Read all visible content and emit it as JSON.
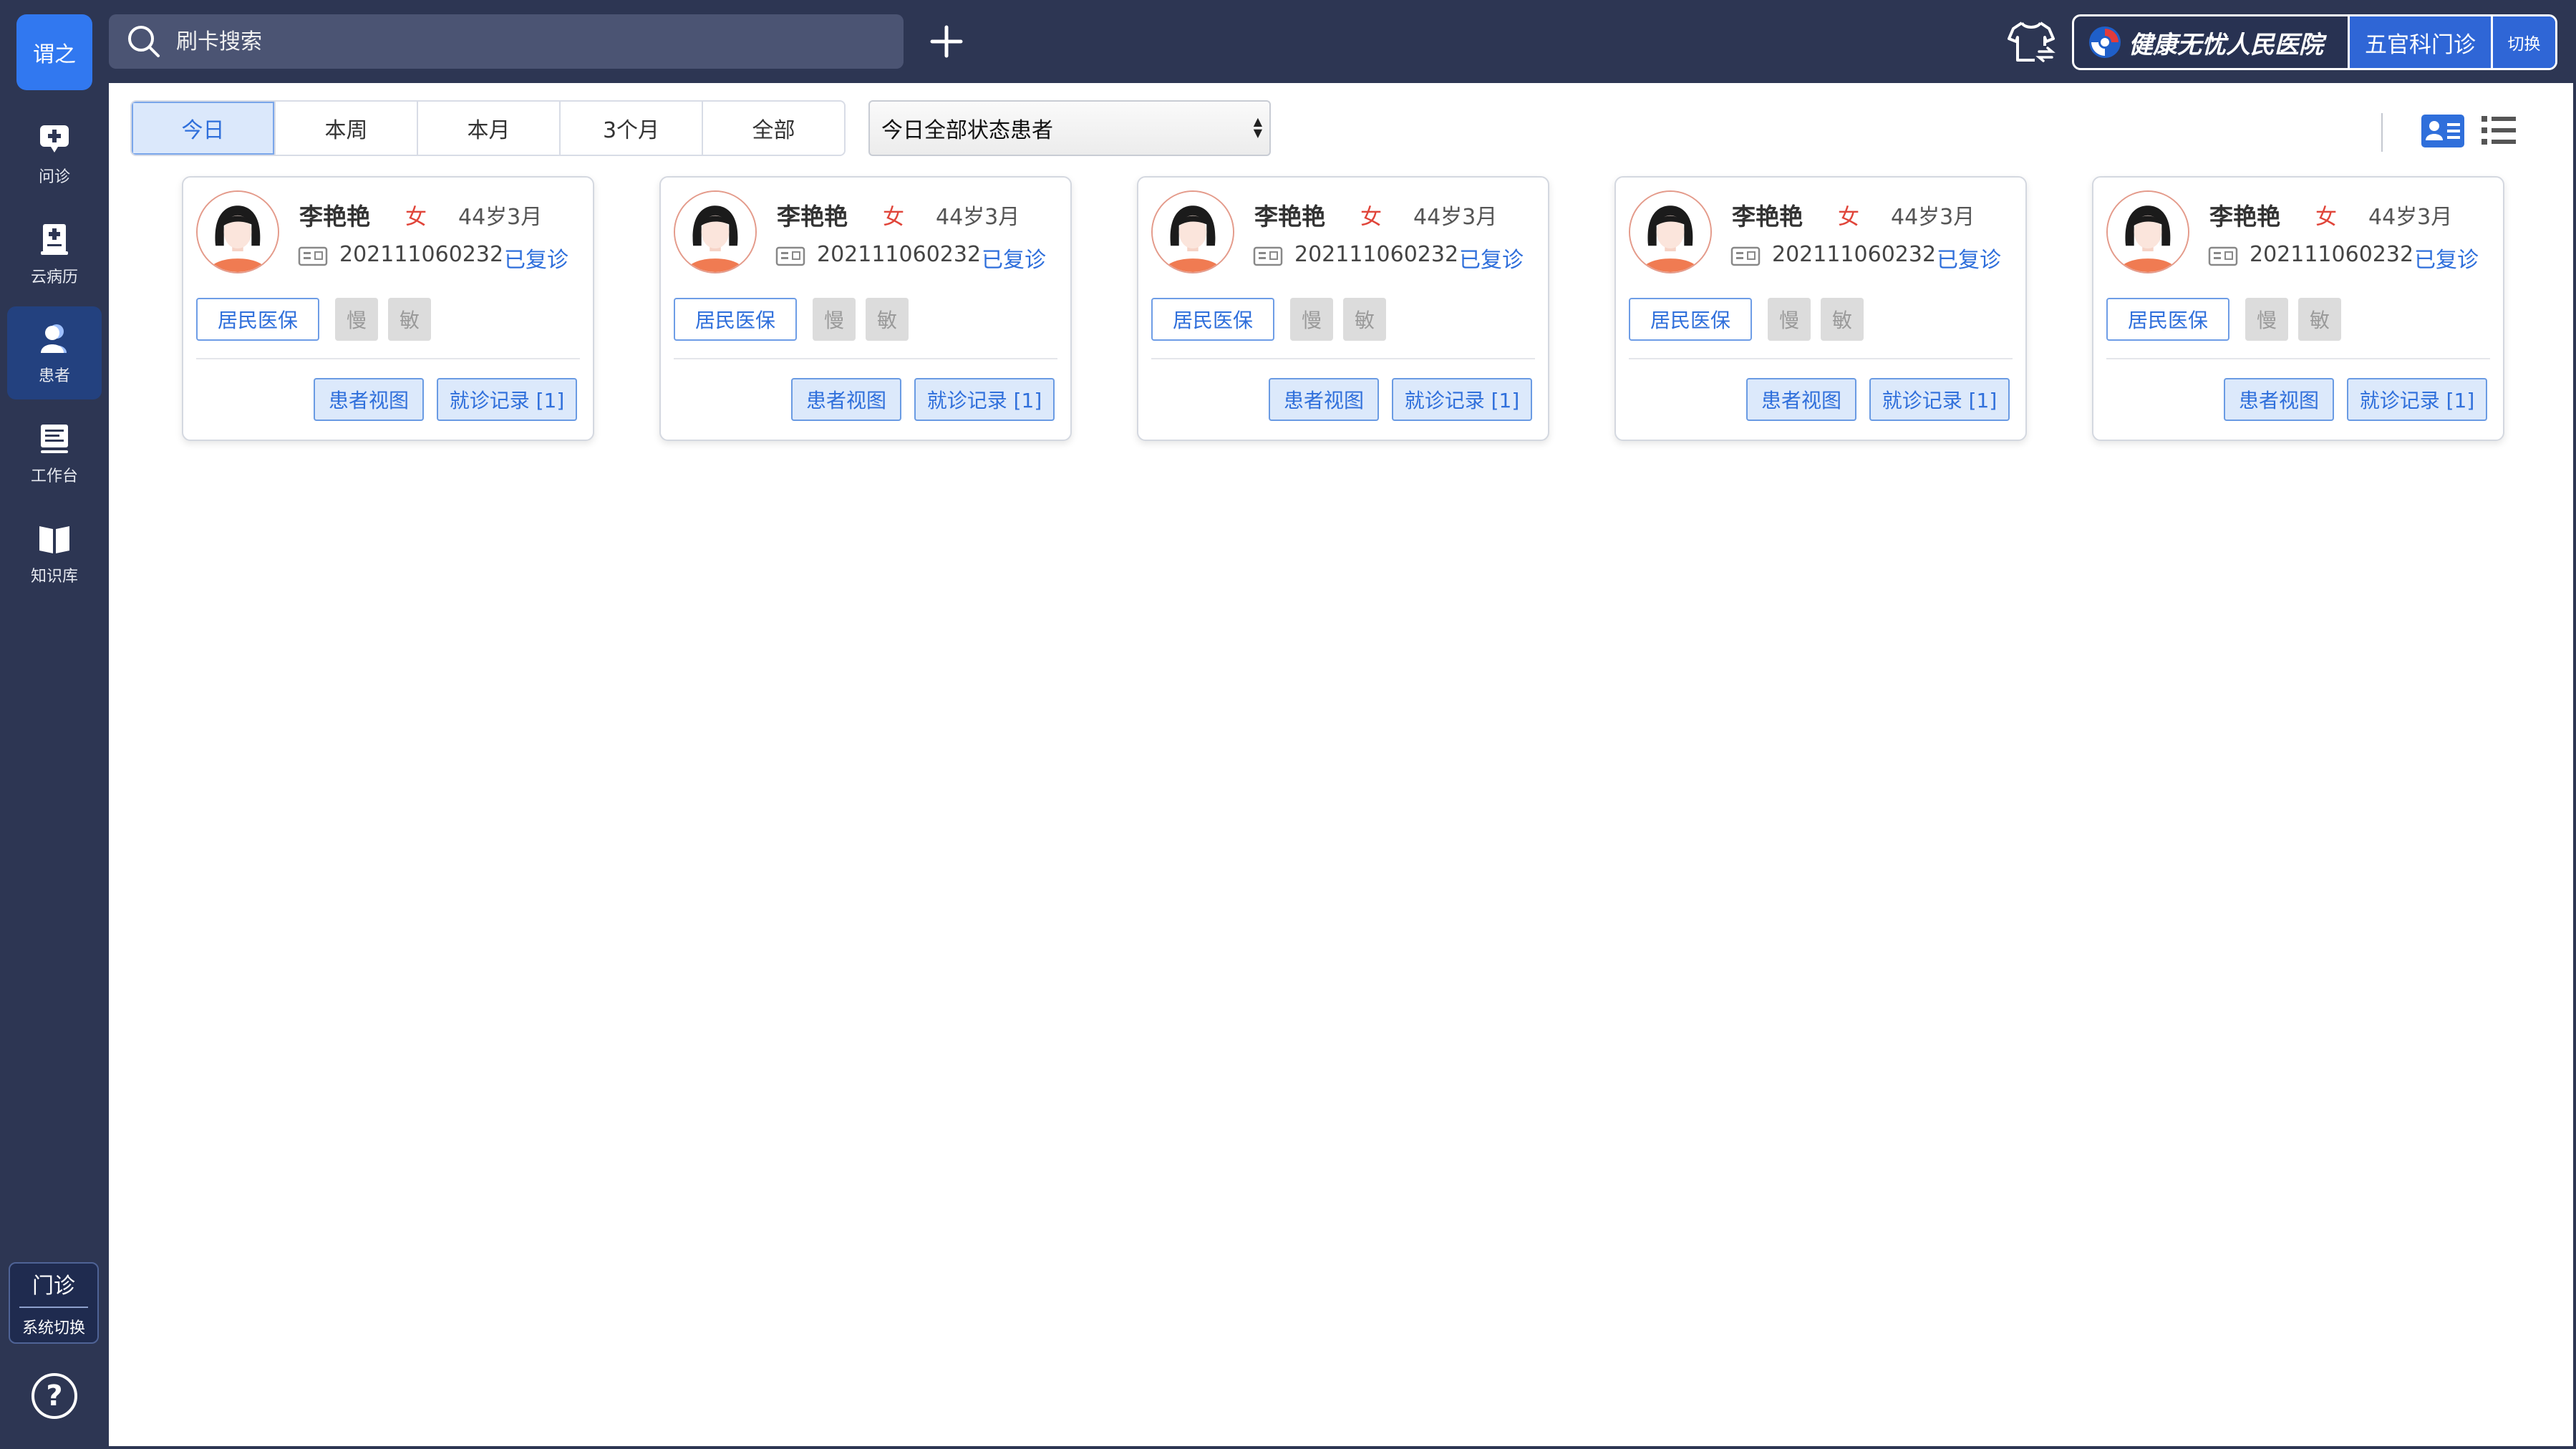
{
  "app": {
    "logo_text": "谓之",
    "accent_color": "#3178f0",
    "sidebar_color": "#2d3653"
  },
  "sidebar": {
    "items": [
      {
        "label": "问诊",
        "icon": "chat-plus-icon",
        "active": false
      },
      {
        "label": "云病历",
        "icon": "record-icon",
        "active": false
      },
      {
        "label": "患者",
        "icon": "patients-icon",
        "active": true
      },
      {
        "label": "工作台",
        "icon": "workbench-icon",
        "active": false
      },
      {
        "label": "知识库",
        "icon": "book-icon",
        "active": false
      }
    ],
    "system_switch": {
      "big": "门诊",
      "small": "系统切换"
    },
    "help_icon": "help-icon"
  },
  "topbar": {
    "search_placeholder": "刷卡搜索",
    "hospital_name": "健康无忧人民医院",
    "department": "五官科门诊",
    "switch_label": "切换"
  },
  "filters": {
    "periods": [
      "今日",
      "本周",
      "本月",
      "3个月",
      "全部"
    ],
    "active_period": "今日",
    "status_select": "今日全部状态患者"
  },
  "patients": [
    {
      "name": "李艳艳",
      "gender": "女",
      "age": "44岁3月",
      "id": "202111060232",
      "status": "已复诊",
      "insurance": "居民医保",
      "tag_chronic": "慢",
      "tag_allergy": "敏",
      "view_btn": "患者视图",
      "records_btn": "就诊记录 [1]"
    },
    {
      "name": "李艳艳",
      "gender": "女",
      "age": "44岁3月",
      "id": "202111060232",
      "status": "已复诊",
      "insurance": "居民医保",
      "tag_chronic": "慢",
      "tag_allergy": "敏",
      "view_btn": "患者视图",
      "records_btn": "就诊记录 [1]"
    },
    {
      "name": "李艳艳",
      "gender": "女",
      "age": "44岁3月",
      "id": "202111060232",
      "status": "已复诊",
      "insurance": "居民医保",
      "tag_chronic": "慢",
      "tag_allergy": "敏",
      "view_btn": "患者视图",
      "records_btn": "就诊记录 [1]"
    },
    {
      "name": "李艳艳",
      "gender": "女",
      "age": "44岁3月",
      "id": "202111060232",
      "status": "已复诊",
      "insurance": "居民医保",
      "tag_chronic": "慢",
      "tag_allergy": "敏",
      "view_btn": "患者视图",
      "records_btn": "就诊记录 [1]"
    },
    {
      "name": "李艳艳",
      "gender": "女",
      "age": "44岁3月",
      "id": "202111060232",
      "status": "已复诊",
      "insurance": "居民医保",
      "tag_chronic": "慢",
      "tag_allergy": "敏",
      "view_btn": "患者视图",
      "records_btn": "就诊记录 [1]"
    }
  ]
}
